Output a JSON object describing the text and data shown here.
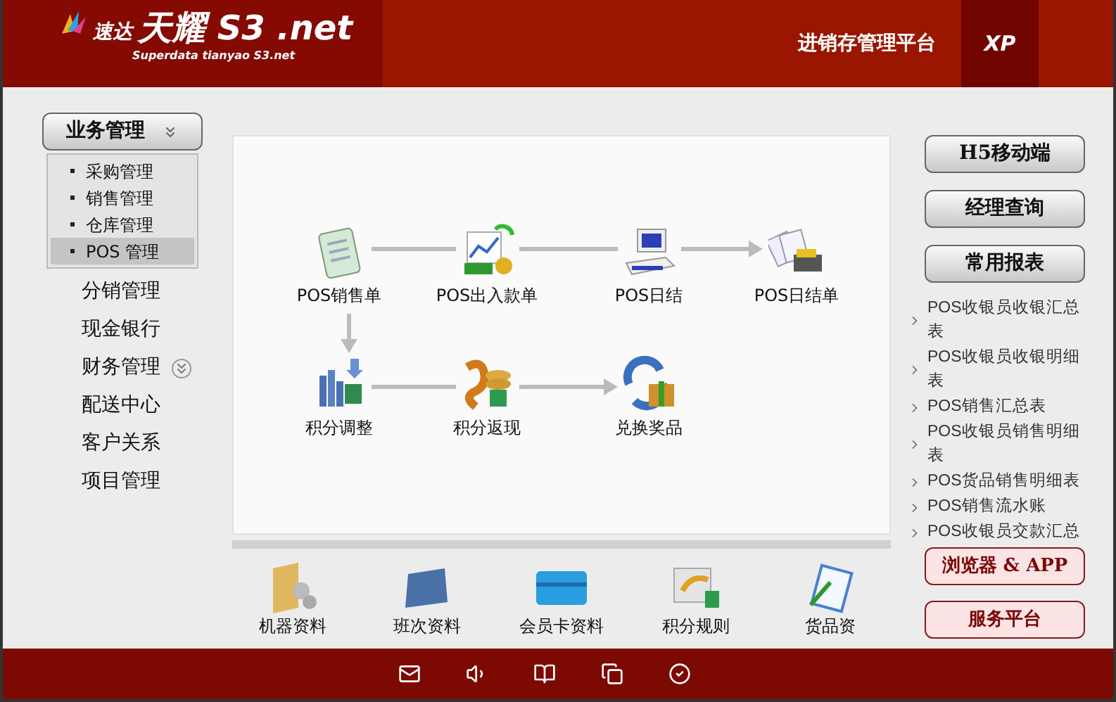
{
  "header": {
    "brand_small": "速达",
    "brand_main": "天耀 S3 .net",
    "brand_sub": "Superdata tianyao S3.net",
    "platform": "进销存管理平台",
    "edition": "XP"
  },
  "sidebar": {
    "menu_button": "业务管理",
    "submenu": [
      {
        "label": "采购管理",
        "selected": false
      },
      {
        "label": "销售管理",
        "selected": false
      },
      {
        "label": "仓库管理",
        "selected": false
      },
      {
        "label": "POS 管理",
        "selected": true
      }
    ],
    "items": [
      {
        "label": "分销管理",
        "expandable": false
      },
      {
        "label": "现金银行",
        "expandable": false
      },
      {
        "label": "财务管理",
        "expandable": true
      },
      {
        "label": "配送中心",
        "expandable": false
      },
      {
        "label": "客户关系",
        "expandable": false
      },
      {
        "label": "项目管理",
        "expandable": false
      }
    ]
  },
  "flow": {
    "nodes": [
      "POS销售单",
      "POS出入款单",
      "POS日结",
      "POS日结单",
      "积分调整",
      "积分返现",
      "兑换奖品"
    ]
  },
  "shortcuts": [
    "机器资料",
    "班次资料",
    "会员卡资料",
    "积分规则",
    "货品资"
  ],
  "right": {
    "buttons": [
      "H5移动端",
      "经理查询",
      "常用报表"
    ],
    "reports": [
      "POS收银员收银汇总表",
      "POS收银员收银明细表",
      "POS销售汇总表",
      "POS收银员销售明细表",
      "POS货品销售明细表",
      "POS销售流水账",
      "POS收银员交款汇总"
    ],
    "bottom_buttons": [
      "浏览器 & APP",
      "服务平台"
    ]
  }
}
